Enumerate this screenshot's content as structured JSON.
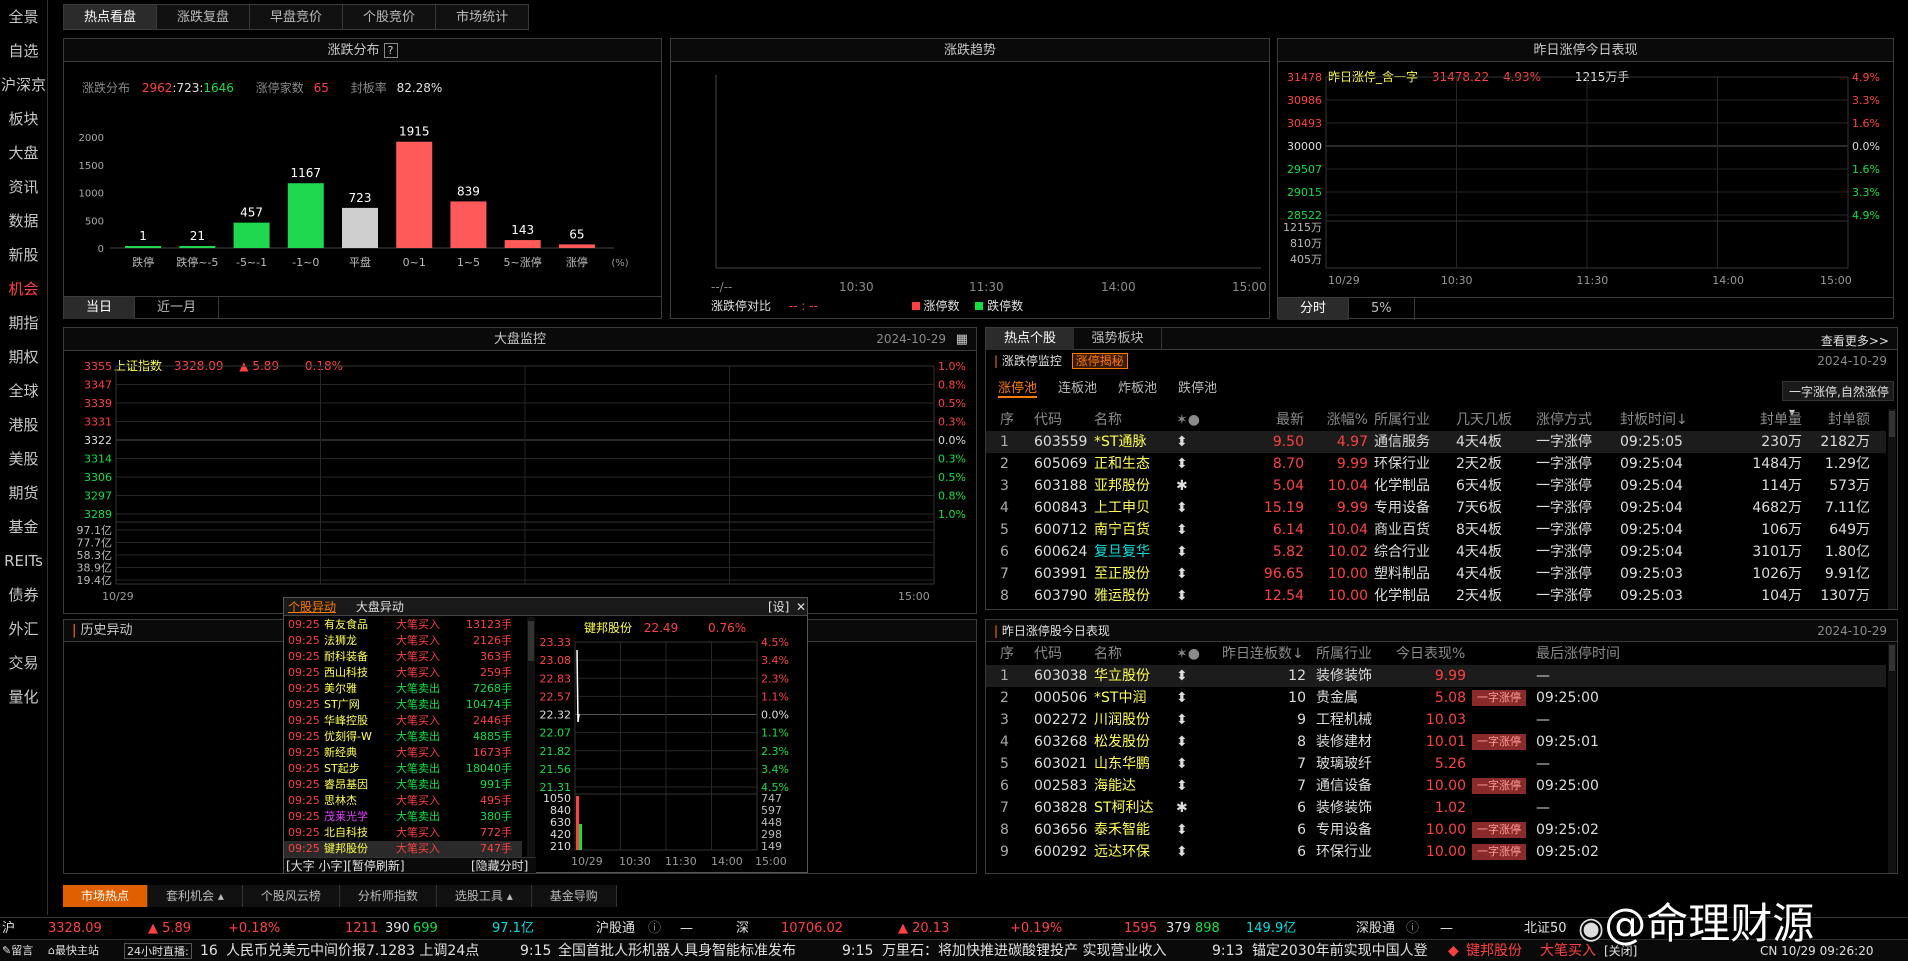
{
  "sidebar": {
    "items": [
      {
        "label": "全景",
        "active": false
      },
      {
        "label": "自选",
        "active": false
      },
      {
        "label": "沪深京",
        "active": false
      },
      {
        "label": "板块",
        "active": false
      },
      {
        "label": "大盘",
        "active": false
      },
      {
        "label": "资讯",
        "active": false
      },
      {
        "label": "数据",
        "active": false
      },
      {
        "label": "新股",
        "active": false
      },
      {
        "label": "机会",
        "active": true
      },
      {
        "label": "期指",
        "active": false
      },
      {
        "label": "期权",
        "active": false
      },
      {
        "label": "全球",
        "active": false
      },
      {
        "label": "港股",
        "active": false
      },
      {
        "label": "美股",
        "active": false
      },
      {
        "label": "期货",
        "active": false
      },
      {
        "label": "基金",
        "active": false
      },
      {
        "label": "REITs",
        "active": false
      },
      {
        "label": "债券",
        "active": false
      },
      {
        "label": "外汇",
        "active": false
      },
      {
        "label": "交易",
        "active": false
      },
      {
        "label": "量化",
        "active": false
      }
    ]
  },
  "top_tabs": [
    "热点看盘",
    "涨跌复盘",
    "早盘竞价",
    "个股竞价",
    "市场统计"
  ],
  "dist": {
    "title": "涨跌分布",
    "help": "?",
    "summary_label": "涨跌分布",
    "up": "2962",
    "flat": "723",
    "down": "1646",
    "sep": ":",
    "limit_label": "涨停家数",
    "limit_val": "65",
    "seal_label": "封板率",
    "seal_val": "82.28%",
    "tabs": [
      "当日",
      "近一月"
    ]
  },
  "trend": {
    "title": "涨跌趋势",
    "xticks": [
      "10:30",
      "11:30",
      "14:00",
      "15:00"
    ],
    "start": "--/--",
    "legend_label": "涨跌停对比",
    "legend_dash": "-- : --",
    "legend_up": "涨停数",
    "legend_down": "跌停数"
  },
  "yest": {
    "title": "昨日涨停今日表现",
    "name": "昨日涨停_含一字",
    "price": "31478.22",
    "pct": "4.93%",
    "vol": "1215万手",
    "y_left": [
      "31478",
      "30986",
      "30493",
      "30000",
      "29507",
      "29015",
      "28522"
    ],
    "y_right": [
      "4.9%",
      "3.3%",
      "1.6%",
      "0.0%",
      "1.6%",
      "3.3%",
      "4.9%"
    ],
    "vol_ticks": [
      "1215万",
      "810万",
      "405万"
    ],
    "xticks": [
      "10/29",
      "10:30",
      "11:30",
      "14:00",
      "15:00"
    ],
    "tabs": [
      "分时",
      "5%"
    ]
  },
  "market": {
    "title": "大盘监控",
    "date": "2024-10-29",
    "index_name": "上证指数",
    "index_val": "3328.09",
    "arrow": "▲",
    "chg": "5.89",
    "pct": "0.18%",
    "y_left": [
      "3355",
      "3347",
      "3339",
      "3331",
      "3322",
      "3314",
      "3306",
      "3297",
      "3289"
    ],
    "y_right": [
      "1.0%",
      "0.8%",
      "0.5%",
      "0.3%",
      "0.0%",
      "0.3%",
      "0.5%",
      "0.8%",
      "1.0%"
    ],
    "vol_ticks": [
      "97.1亿",
      "77.7亿",
      "58.3亿",
      "38.9亿",
      "19.4亿"
    ],
    "x_start": "10/29",
    "x_end": "15:00"
  },
  "history": {
    "title": "历史异动"
  },
  "abn": {
    "tabs": [
      "个股异动",
      "大盘异动"
    ],
    "settings": "[设]",
    "close": "✕",
    "rows": [
      {
        "t": "09:25",
        "n": "有友食品",
        "a": "大笔买入",
        "v": "13123手",
        "c": "red"
      },
      {
        "t": "09:25",
        "n": "法狮龙",
        "a": "大笔买入",
        "v": "2126手",
        "c": "red"
      },
      {
        "t": "09:25",
        "n": "耐科装备",
        "a": "大笔买入",
        "v": "363手",
        "c": "red"
      },
      {
        "t": "09:25",
        "n": "西山科技",
        "a": "大笔买入",
        "v": "259手",
        "c": "red"
      },
      {
        "t": "09:25",
        "n": "美尔雅",
        "a": "大笔卖出",
        "v": "7268手",
        "c": "grn"
      },
      {
        "t": "09:25",
        "n": "ST广网",
        "a": "大笔卖出",
        "v": "10474手",
        "c": "grn"
      },
      {
        "t": "09:25",
        "n": "华峰控股",
        "a": "大笔买入",
        "v": "2446手",
        "c": "red"
      },
      {
        "t": "09:25",
        "n": "优刻得-W",
        "a": "大笔卖出",
        "v": "4885手",
        "c": "grn"
      },
      {
        "t": "09:25",
        "n": "新经典",
        "a": "大笔买入",
        "v": "1673手",
        "c": "red"
      },
      {
        "t": "09:25",
        "n": "ST起步",
        "a": "大笔卖出",
        "v": "18040手",
        "c": "grn"
      },
      {
        "t": "09:25",
        "n": "睿昂基因",
        "a": "大笔卖出",
        "v": "991手",
        "c": "grn"
      },
      {
        "t": "09:25",
        "n": "思林杰",
        "a": "大笔买入",
        "v": "495手",
        "c": "red"
      },
      {
        "t": "09:25",
        "n": "茂莱光学",
        "a": "大笔卖出",
        "v": "380手",
        "c": "grn"
      },
      {
        "t": "09:25",
        "n": "北自科技",
        "a": "大笔买入",
        "v": "772手",
        "c": "red"
      },
      {
        "t": "09:25",
        "n": "键邦股份",
        "a": "大笔买入",
        "v": "747手",
        "c": "red"
      }
    ],
    "footer_left": "[大字 小字][暂停刷新]",
    "footer_right": "[隐藏分时]",
    "mini": {
      "name": "键邦股份",
      "price": "22.49",
      "pct": "0.76%",
      "y_left": [
        "23.33",
        "23.08",
        "22.83",
        "22.57",
        "22.32",
        "22.07",
        "21.82",
        "21.56",
        "21.31"
      ],
      "y_right": [
        "4.5%",
        "3.4%",
        "2.3%",
        "1.1%",
        "0.0%",
        "1.1%",
        "2.3%",
        "3.4%",
        "4.5%"
      ],
      "vol_left": [
        "1050",
        "840",
        "630",
        "420",
        "210"
      ],
      "vol_right": [
        "747",
        "597",
        "448",
        "298",
        "149"
      ],
      "xticks": [
        "10/29",
        "10:30",
        "11:30",
        "14:00",
        "15:00"
      ]
    }
  },
  "hot": {
    "tabs": [
      "热点个股",
      "强势板块"
    ],
    "more": "查看更多>>",
    "sub_label": "涨跌停监控",
    "sub_tag": "涨停揭秘",
    "date": "2024-10-29",
    "pool_tabs": [
      "涨停池",
      "连板池",
      "炸板池",
      "跌停池"
    ],
    "sort": "一字涨停,自然涨停",
    "headers": [
      "序",
      "代码",
      "名称",
      "✶●",
      "最新",
      "涨幅%",
      "所属行业",
      "几天几板",
      "涨停方式",
      "封板时间↓",
      "封单量",
      "封单额"
    ],
    "rows": [
      {
        "i": "1",
        "code": "603559",
        "name": "*ST通脉",
        "ic": "⬍",
        "price": "9.50",
        "pct": "4.97",
        "ind": "通信服务",
        "days": "4天4板",
        "way": "一字涨停",
        "time": "09:25:05",
        "vol": "230万",
        "amt": "2182万"
      },
      {
        "i": "2",
        "code": "605069",
        "name": "正和生态",
        "ic": "⬍",
        "price": "8.70",
        "pct": "9.99",
        "ind": "环保行业",
        "days": "2天2板",
        "way": "一字涨停",
        "time": "09:25:04",
        "vol": "1484万",
        "amt": "1.29亿"
      },
      {
        "i": "3",
        "code": "603188",
        "name": "亚邦股份",
        "ic": "✱",
        "price": "5.04",
        "pct": "10.04",
        "ind": "化学制品",
        "days": "6天4板",
        "way": "一字涨停",
        "time": "09:25:04",
        "vol": "114万",
        "amt": "573万"
      },
      {
        "i": "4",
        "code": "600843",
        "name": "上工申贝",
        "ic": "⬍",
        "price": "15.19",
        "pct": "9.99",
        "ind": "专用设备",
        "days": "7天6板",
        "way": "一字涨停",
        "time": "09:25:04",
        "vol": "4682万",
        "amt": "7.11亿"
      },
      {
        "i": "5",
        "code": "600712",
        "name": "南宁百货",
        "ic": "⬍",
        "price": "6.14",
        "pct": "10.04",
        "ind": "商业百货",
        "days": "8天4板",
        "way": "一字涨停",
        "time": "09:25:04",
        "vol": "106万",
        "amt": "649万"
      },
      {
        "i": "6",
        "code": "600624",
        "name": "复旦复华",
        "ic": "⬍",
        "price": "5.82",
        "pct": "10.02",
        "ind": "综合行业",
        "days": "4天4板",
        "way": "一字涨停",
        "time": "09:25:04",
        "vol": "3101万",
        "amt": "1.80亿"
      },
      {
        "i": "7",
        "code": "603991",
        "name": "至正股份",
        "ic": "⬍",
        "price": "96.65",
        "pct": "10.00",
        "ind": "塑料制品",
        "days": "4天4板",
        "way": "一字涨停",
        "time": "09:25:03",
        "vol": "1026万",
        "amt": "9.91亿"
      },
      {
        "i": "8",
        "code": "603790",
        "name": "雅运股份",
        "ic": "⬍",
        "price": "12.54",
        "pct": "10.00",
        "ind": "化学制品",
        "days": "2天4板",
        "way": "一字涨停",
        "time": "09:25:03",
        "vol": "104万",
        "amt": "1307万"
      }
    ]
  },
  "yperf": {
    "title": "昨日涨停股今日表现",
    "date": "2024-10-29",
    "headers": [
      "序",
      "代码",
      "名称",
      "✶●",
      "昨日连板数↓",
      "所属行业",
      "今日表现%",
      "最后涨停时间"
    ],
    "rows": [
      {
        "i": "1",
        "code": "603038",
        "name": "华立股份",
        "ic": "⬍",
        "n": "12",
        "ind": "装修装饰",
        "pct": "9.99",
        "tag": "",
        "time": "—"
      },
      {
        "i": "2",
        "code": "000506",
        "name": "*ST中润",
        "ic": "⬍",
        "n": "10",
        "ind": "贵金属",
        "pct": "5.08",
        "tag": "一字涨停",
        "time": "09:25:00"
      },
      {
        "i": "3",
        "code": "002272",
        "name": "川润股份",
        "ic": "⬍",
        "n": "9",
        "ind": "工程机械",
        "pct": "10.03",
        "tag": "",
        "time": "—"
      },
      {
        "i": "4",
        "code": "603268",
        "name": "松发股份",
        "ic": "⬍",
        "n": "8",
        "ind": "装修建材",
        "pct": "10.01",
        "tag": "一字涨停",
        "time": "09:25:01"
      },
      {
        "i": "5",
        "code": "603021",
        "name": "山东华鹏",
        "ic": "⬍",
        "n": "7",
        "ind": "玻璃玻纤",
        "pct": "5.26",
        "tag": "",
        "time": "—"
      },
      {
        "i": "6",
        "code": "002583",
        "name": "海能达",
        "ic": "⬍",
        "n": "7",
        "ind": "通信设备",
        "pct": "10.00",
        "tag": "一字涨停",
        "time": "09:25:00"
      },
      {
        "i": "7",
        "code": "603828",
        "name": "ST柯利达",
        "ic": "✱",
        "n": "6",
        "ind": "装修装饰",
        "pct": "1.02",
        "tag": "",
        "time": "—"
      },
      {
        "i": "8",
        "code": "603656",
        "name": "泰禾智能",
        "ic": "⬍",
        "n": "6",
        "ind": "专用设备",
        "pct": "10.00",
        "tag": "一字涨停",
        "time": "09:25:02"
      },
      {
        "i": "9",
        "code": "600292",
        "name": "远达环保",
        "ic": "⬍",
        "n": "6",
        "ind": "环保行业",
        "pct": "10.00",
        "tag": "一字涨停",
        "time": "09:25:02"
      }
    ]
  },
  "bottom_tabs": [
    "市场热点",
    "套利机会 ▴",
    "个股风云榜",
    "分析师指数",
    "选股工具 ▴",
    "基金导购"
  ],
  "ticker": {
    "sh_label": "沪",
    "sh_val": "3328.09",
    "sh_chg": "▲ 5.89",
    "sh_pct": "+0.18%",
    "sh_amt": "1211",
    "sh_up": "390",
    "sh_flat": "699",
    "sh_turn": "97.1亿",
    "hgt_label": "沪股通",
    "hgt_val": "—",
    "sz_label": "深",
    "sz_val": "10706.02",
    "sz_chg": "▲ 20.13",
    "sz_pct": "+0.19%",
    "sz_amt": "1595",
    "sz_up": "379",
    "sz_flat": "898",
    "sz_turn": "149.9亿",
    "sgt_label": "深股通",
    "sgt_val": "—",
    "bz_label": "北证50"
  },
  "news": {
    "left1": "留言",
    "left2": "最快主站",
    "live": "24小时直播:",
    "live_n": "16",
    "items": [
      {
        "t": "",
        "txt": "人民币兑美元中间价报7.1283 上调24点"
      },
      {
        "t": "9:15",
        "txt": "全国首批人形机器人具身智能标准发布"
      },
      {
        "t": "9:15",
        "txt": "万里石：将加快推进碳酸锂投产 实现营业收入"
      },
      {
        "t": "9:13",
        "txt": "锚定2030年前实现中国人登"
      }
    ],
    "alert_name": "键邦股份",
    "alert_act": "大笔买入",
    "alert_close": "[关闭]",
    "status": "CN 10/29 09:26:20"
  },
  "watermark": "@命理财源",
  "chart_data": [
    {
      "type": "bar",
      "title": "涨跌分布",
      "categories": [
        "跌停",
        "跌停~-5",
        "-5~-1",
        "-1~0",
        "平盘",
        "0~1",
        "1~5",
        "5~涨停",
        "涨停"
      ],
      "values": [
        1,
        21,
        457,
        1167,
        723,
        1915,
        839,
        143,
        65
      ],
      "unit": "(%)",
      "yticks": [
        0,
        500,
        1000,
        1500,
        2000
      ],
      "ylim": [
        0,
        2000
      ],
      "colors": [
        "#20d850",
        "#20d850",
        "#20d850",
        "#20d850",
        "#cfcfcf",
        "#ff5a5a",
        "#ff5a5a",
        "#ff5a5a",
        "#ff5a5a"
      ]
    }
  ]
}
